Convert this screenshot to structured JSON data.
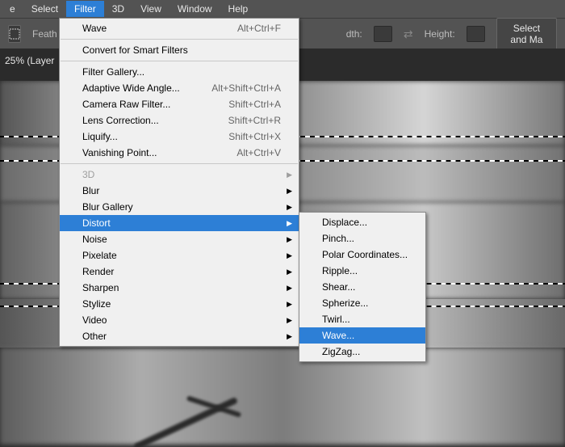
{
  "menubar": {
    "items": [
      "e",
      "Select",
      "Filter",
      "3D",
      "View",
      "Window",
      "Help"
    ],
    "activeIndex": 2
  },
  "options": {
    "feather": "Feath",
    "widthSuffix": "dth:",
    "height": "Height:",
    "selectMask": "Select and Ma"
  },
  "doc": {
    "zoom": "25% (Layer"
  },
  "filterMenu": {
    "lastFilter": {
      "label": "Wave",
      "shortcut": "Alt+Ctrl+F"
    },
    "convert": "Convert for Smart Filters",
    "group1": [
      {
        "label": "Filter Gallery...",
        "shortcut": ""
      },
      {
        "label": "Adaptive Wide Angle...",
        "shortcut": "Alt+Shift+Ctrl+A"
      },
      {
        "label": "Camera Raw Filter...",
        "shortcut": "Shift+Ctrl+A"
      },
      {
        "label": "Lens Correction...",
        "shortcut": "Shift+Ctrl+R"
      },
      {
        "label": "Liquify...",
        "shortcut": "Shift+Ctrl+X"
      },
      {
        "label": "Vanishing Point...",
        "shortcut": "Alt+Ctrl+V"
      }
    ],
    "group2": [
      {
        "label": "3D",
        "disabled": true
      },
      {
        "label": "Blur"
      },
      {
        "label": "Blur Gallery"
      },
      {
        "label": "Distort",
        "highlighted": true
      },
      {
        "label": "Noise"
      },
      {
        "label": "Pixelate"
      },
      {
        "label": "Render"
      },
      {
        "label": "Sharpen"
      },
      {
        "label": "Stylize"
      },
      {
        "label": "Video"
      },
      {
        "label": "Other"
      }
    ]
  },
  "distortSubmenu": {
    "items": [
      {
        "label": "Displace..."
      },
      {
        "label": "Pinch..."
      },
      {
        "label": "Polar Coordinates..."
      },
      {
        "label": "Ripple..."
      },
      {
        "label": "Shear..."
      },
      {
        "label": "Spherize..."
      },
      {
        "label": "Twirl..."
      },
      {
        "label": "Wave...",
        "highlighted": true
      },
      {
        "label": "ZigZag..."
      }
    ]
  }
}
